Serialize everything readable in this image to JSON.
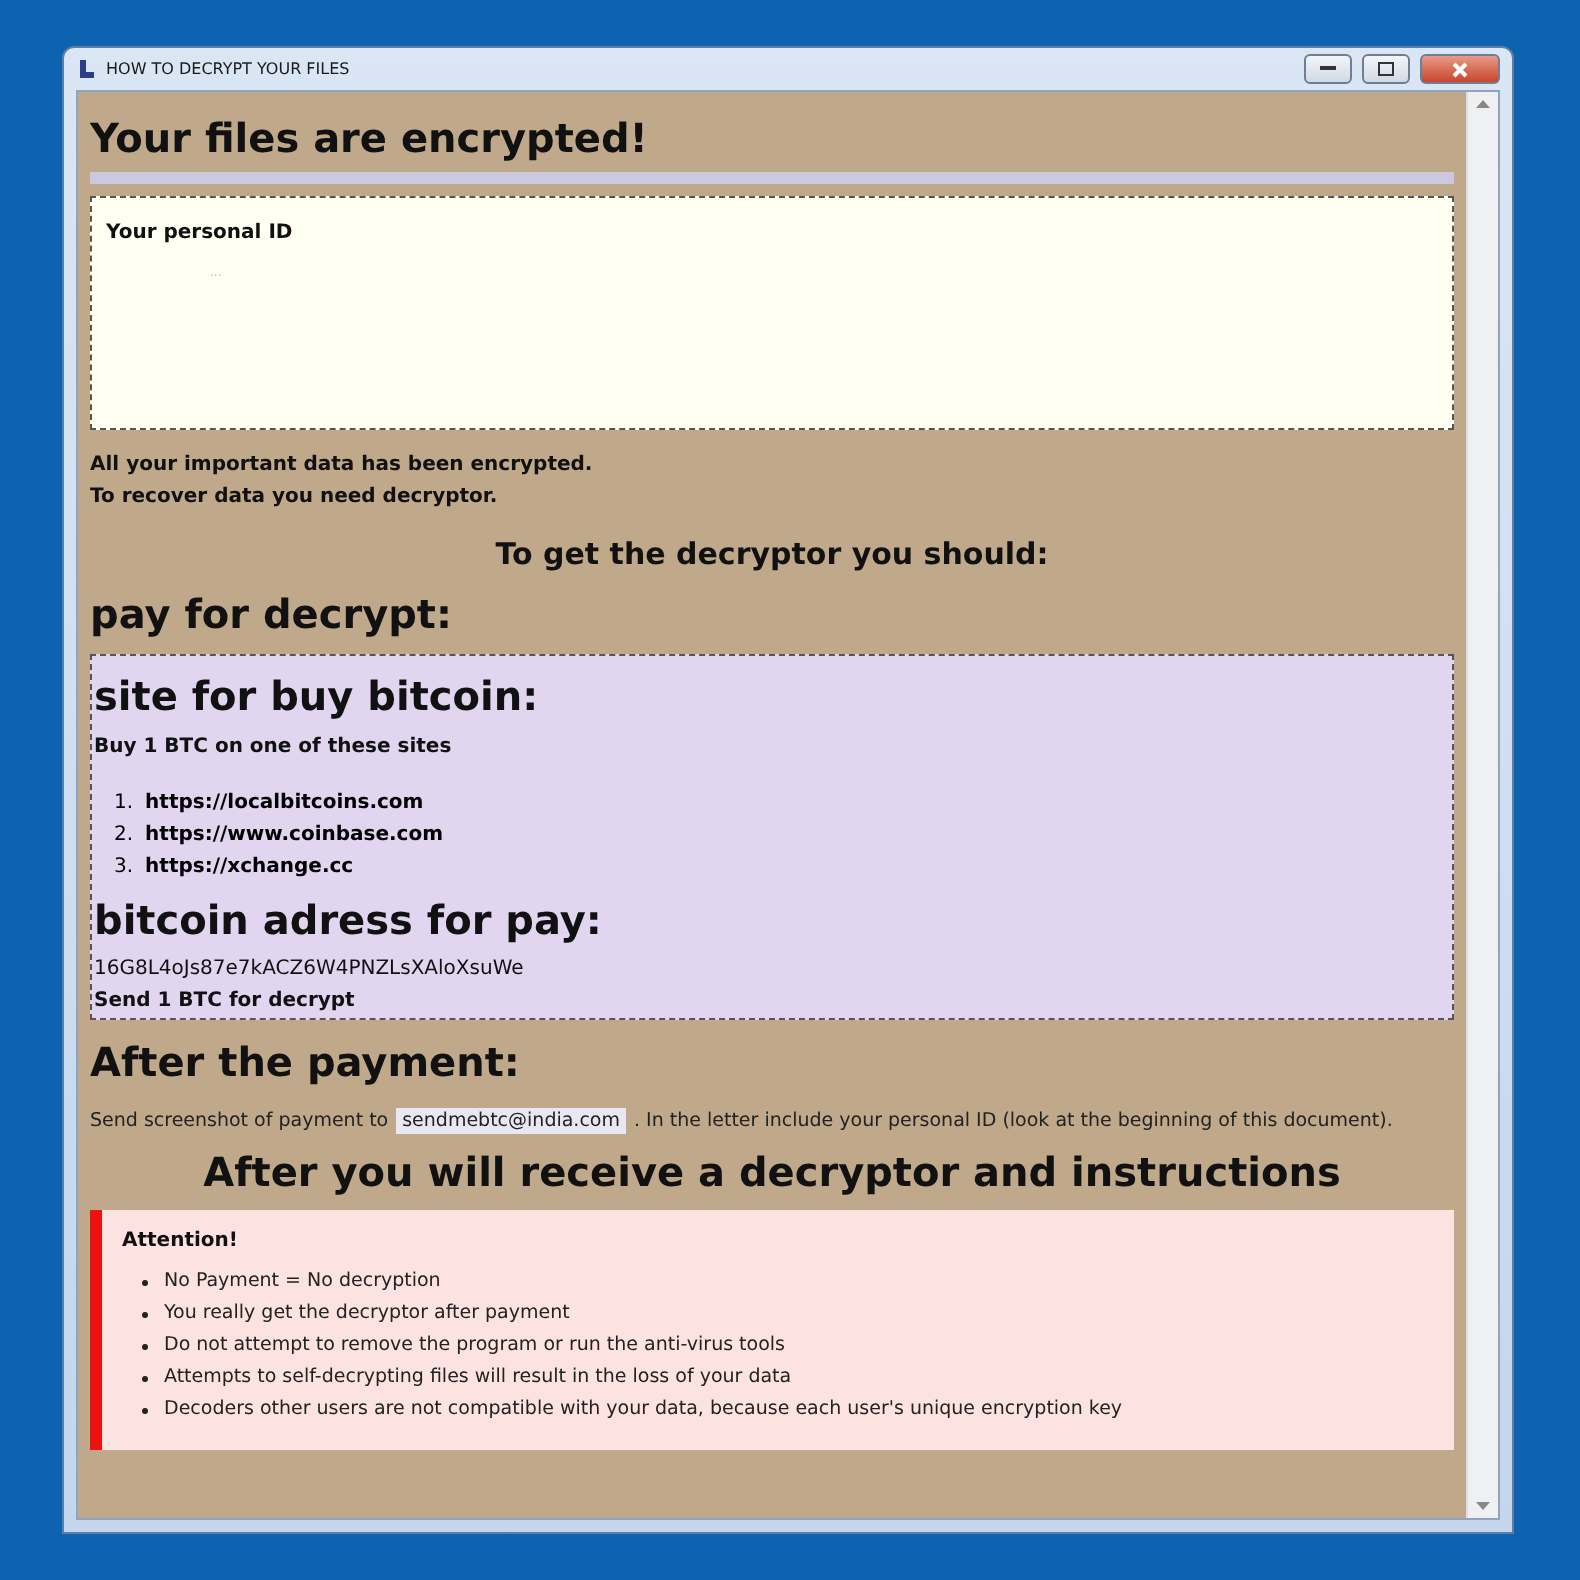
{
  "window": {
    "title": "HOW TO DECRYPT YOUR FILES"
  },
  "heading": "Your files are encrypted!",
  "id_box": {
    "label": "Your personal ID",
    "value": "..."
  },
  "notice": [
    "All your important data has been encrypted.",
    "To recover data you need decryptor."
  ],
  "instruction_heading": "To get the decryptor you should:",
  "pay_heading": "pay for decrypt:",
  "bitcoin_box": {
    "heading": "site for buy bitcoin:",
    "intro": "Buy 1 BTC on one of these sites",
    "sites": [
      {
        "number": "1.",
        "url": "https://localbitcoins.com"
      },
      {
        "number": "2.",
        "url": "https://www.coinbase.com"
      },
      {
        "number": "3.",
        "url": "https://xchange.cc"
      }
    ],
    "address_heading": "bitcoin adress for pay:",
    "address": "16G8L4oJs87e7kACZ6W4PNZLsXAloXsuWe",
    "send_note": "Send 1 BTC for decrypt"
  },
  "after_payment": {
    "heading": "After the payment:",
    "text_before": "Send screenshot of payment to",
    "email": "sendmebtc@india.com",
    "text_after": ". In the letter include your personal ID (look at the beginning of this document)."
  },
  "final_heading": "After you will receive a decryptor and instructions",
  "attention": {
    "title": "Attention!",
    "items": [
      "No Payment = No decryption",
      "You really get the decryptor after payment",
      "Do not attempt to remove the program or run the anti-virus tools",
      "Attempts to self-decrypting files will result in the loss of your data",
      "Decoders other users are not compatible with your data, because each user's unique encryption key"
    ]
  }
}
